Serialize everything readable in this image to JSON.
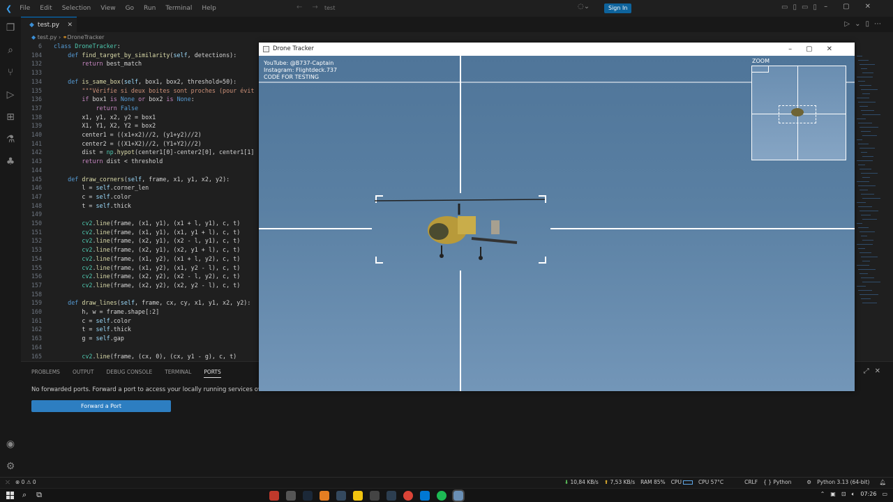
{
  "titlebar": {
    "menu": [
      "File",
      "Edit",
      "Selection",
      "View",
      "Go",
      "Run",
      "Terminal",
      "Help"
    ],
    "search_text": "test",
    "signin_label": "Sign In"
  },
  "tabs": [
    {
      "label": "test.py",
      "active": true
    }
  ],
  "breadcrumb": {
    "file": "test.py",
    "symbol": "DroneTracker"
  },
  "code_lines": [
    {
      "n": "6",
      "t": "class DroneTracker:"
    },
    {
      "n": "104",
      "t": "    def find_target_by_similarity(self, detections):"
    },
    {
      "n": "132",
      "t": "        return best_match"
    },
    {
      "n": "133",
      "t": ""
    },
    {
      "n": "134",
      "t": "    def is_same_box(self, box1, box2, threshold=50):"
    },
    {
      "n": "135",
      "t": "        \"\"\"Vérifie si deux boites sont proches (pour évit"
    },
    {
      "n": "136",
      "t": "        if box1 is None or box2 is None:"
    },
    {
      "n": "137",
      "t": "            return False"
    },
    {
      "n": "138",
      "t": "        x1, y1, x2, y2 = box1"
    },
    {
      "n": "139",
      "t": "        X1, Y1, X2, Y2 = box2"
    },
    {
      "n": "140",
      "t": "        center1 = ((x1+x2)//2, (y1+y2)//2)"
    },
    {
      "n": "141",
      "t": "        center2 = ((X1+X2)//2, (Y1+Y2)//2)"
    },
    {
      "n": "142",
      "t": "        dist = np.hypot(center1[0]-center2[0], center1[1]"
    },
    {
      "n": "143",
      "t": "        return dist < threshold"
    },
    {
      "n": "144",
      "t": ""
    },
    {
      "n": "145",
      "t": "    def draw_corners(self, frame, x1, y1, x2, y2):"
    },
    {
      "n": "146",
      "t": "        l = self.corner_len"
    },
    {
      "n": "147",
      "t": "        c = self.color"
    },
    {
      "n": "148",
      "t": "        t = self.thick"
    },
    {
      "n": "149",
      "t": ""
    },
    {
      "n": "150",
      "t": "        cv2.line(frame, (x1, y1), (x1 + l, y1), c, t)"
    },
    {
      "n": "151",
      "t": "        cv2.line(frame, (x1, y1), (x1, y1 + l), c, t)"
    },
    {
      "n": "152",
      "t": "        cv2.line(frame, (x2, y1), (x2 - l, y1), c, t)"
    },
    {
      "n": "153",
      "t": "        cv2.line(frame, (x2, y1), (x2, y1 + l), c, t)"
    },
    {
      "n": "154",
      "t": "        cv2.line(frame, (x1, y2), (x1 + l, y2), c, t)"
    },
    {
      "n": "155",
      "t": "        cv2.line(frame, (x1, y2), (x1, y2 - l), c, t)"
    },
    {
      "n": "156",
      "t": "        cv2.line(frame, (x2, y2), (x2 - l, y2), c, t)"
    },
    {
      "n": "157",
      "t": "        cv2.line(frame, (x2, y2), (x2, y2 - l), c, t)"
    },
    {
      "n": "158",
      "t": ""
    },
    {
      "n": "159",
      "t": "    def draw_lines(self, frame, cx, cy, x1, y1, x2, y2):"
    },
    {
      "n": "160",
      "t": "        h, w = frame.shape[:2]"
    },
    {
      "n": "161",
      "t": "        c = self.color"
    },
    {
      "n": "162",
      "t": "        t = self.thick"
    },
    {
      "n": "163",
      "t": "        g = self.gap"
    },
    {
      "n": "164",
      "t": ""
    },
    {
      "n": "165",
      "t": "        cv2.line(frame, (cx, 0), (cx, y1 - g), c, t)"
    }
  ],
  "panel": {
    "tabs": [
      "PROBLEMS",
      "OUTPUT",
      "DEBUG CONSOLE",
      "TERMINAL",
      "PORTS"
    ],
    "active_tab": "PORTS",
    "message": "No forwarded ports. Forward a port to access your locally running services over the in",
    "forward_button": "Forward a Port"
  },
  "status": {
    "problems": "⊗ 0 ⚠ 0",
    "net_down": "10,84 KB/s",
    "net_up": "7,53 KB/s",
    "ram": "RAM 85%",
    "cpu": "CPU",
    "cpu_temp": "CPU 57°C",
    "eol": "CRLF",
    "language": "{ } Python",
    "interpreter": "Python 3.13 (64-bit)"
  },
  "window": {
    "title": "Drone Tracker",
    "overlay_lines": [
      "YouTube: @B737-Captain",
      "Instagram: Flightdeck.737",
      "CODE FOR TESTING"
    ],
    "zoom_label": "ZOOM"
  },
  "taskbar": {
    "time": "07:26"
  },
  "colors": {
    "accent": "#0078d4",
    "signin": "#0e639c",
    "forward": "#2d7ec1",
    "sky": "#5a80a3",
    "keyword": "#c586c0",
    "function": "#dcdcaa",
    "string": "#ce9178",
    "def": "#569cd6",
    "class": "#4ec9b0"
  }
}
